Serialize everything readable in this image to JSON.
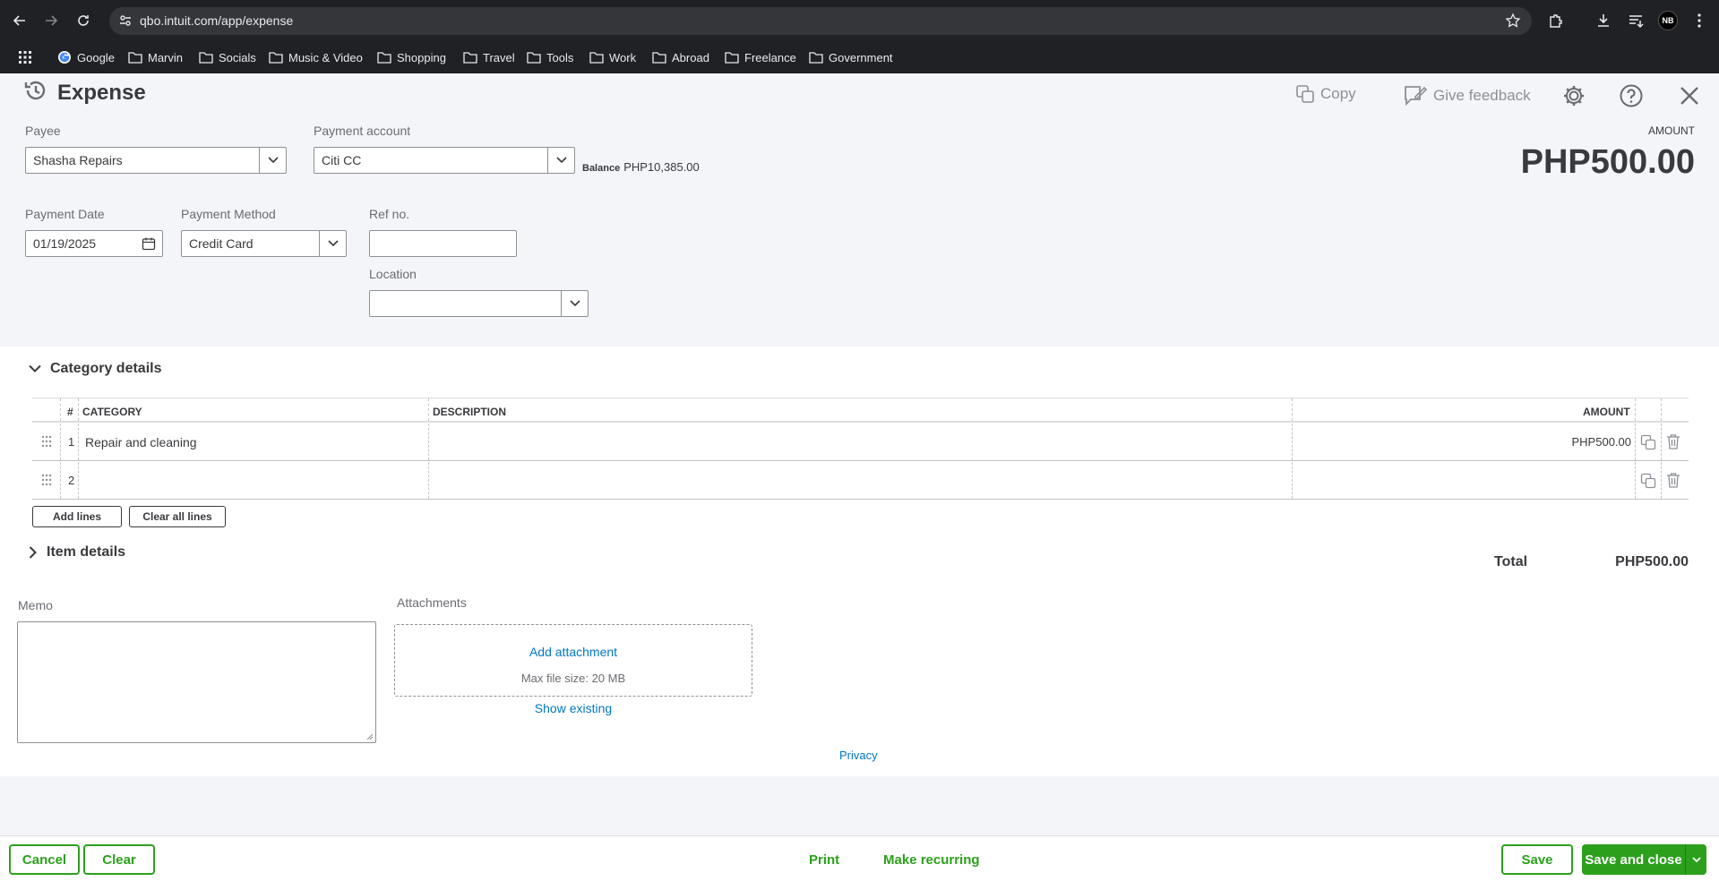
{
  "browser": {
    "url": "qbo.intuit.com/app/expense",
    "profile_initials": "NB",
    "bookmarks": [
      "Google",
      "Marvin",
      "Socials",
      "Music & Video",
      "Shopping",
      "Travel",
      "Tools",
      "Work",
      "Abroad",
      "Freelance",
      "Government"
    ]
  },
  "header": {
    "title": "Expense",
    "copy_label": "Copy",
    "feedback_label": "Give feedback",
    "payee_label": "Payee",
    "payee_value": "Shasha Repairs",
    "payment_account_label": "Payment account",
    "payment_account_value": "Citi CC",
    "balance_label": "Balance",
    "balance_value": "PHP10,385.00",
    "amount_label": "AMOUNT",
    "amount_value": "PHP500.00",
    "payment_date_label": "Payment Date",
    "payment_date_value": "01/19/2025",
    "payment_method_label": "Payment Method",
    "payment_method_value": "Credit Card",
    "ref_label": "Ref no.",
    "ref_value": "",
    "location_label": "Location",
    "location_value": ""
  },
  "category": {
    "title": "Category details",
    "columns": [
      "#",
      "CATEGORY",
      "DESCRIPTION",
      "AMOUNT"
    ],
    "rows": [
      {
        "num": "1",
        "category": "Repair and cleaning",
        "description": "",
        "amount": "PHP500.00"
      },
      {
        "num": "2",
        "category": "",
        "description": "",
        "amount": ""
      }
    ],
    "add_lines": "Add lines",
    "clear_lines": "Clear all lines"
  },
  "item_details": {
    "title": "Item details"
  },
  "totals": {
    "label": "Total",
    "value": "PHP500.00"
  },
  "memo": {
    "label": "Memo",
    "value": ""
  },
  "attachments": {
    "label": "Attachments",
    "add": "Add attachment",
    "max_size": "Max file size: 20 MB",
    "show_existing": "Show existing"
  },
  "privacy": "Privacy",
  "footer": {
    "cancel": "Cancel",
    "clear": "Clear",
    "print": "Print",
    "make_recurring": "Make recurring",
    "save": "Save",
    "save_and_close": "Save and close"
  },
  "colors": {
    "accent": "#2ca01c",
    "link": "#0077c5",
    "text": "#393a3d"
  }
}
